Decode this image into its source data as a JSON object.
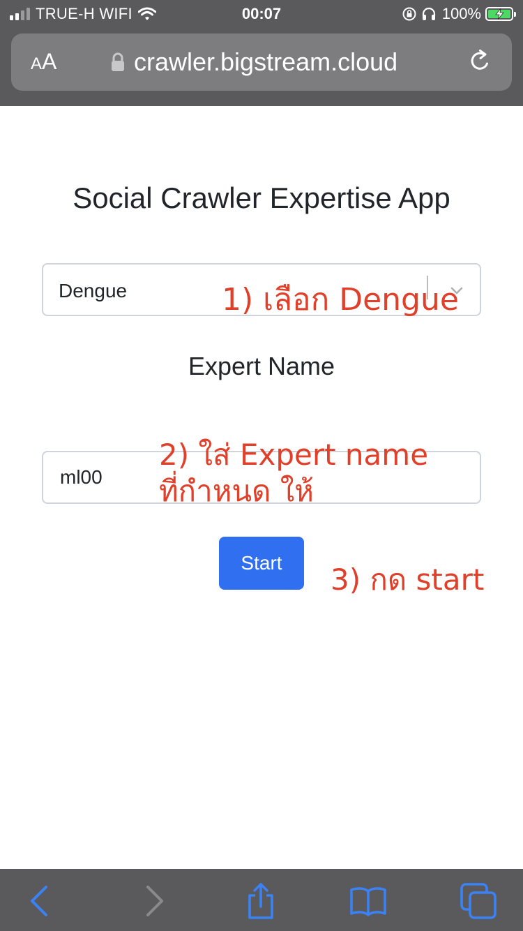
{
  "status_bar": {
    "carrier": "TRUE-H WIFI",
    "time": "00:07",
    "battery_percent": "100%",
    "signal_bars_active": 2,
    "signal_bars_total": 4,
    "battery_level": 1.0,
    "charging": true
  },
  "browser": {
    "text_size_label_small": "A",
    "text_size_label_large": "A",
    "url": "crawler.bigstream.cloud",
    "icons": {
      "lock": "lock-icon",
      "reload": "reload-icon",
      "back": "back-icon",
      "forward": "forward-icon",
      "share": "share-icon",
      "bookmarks": "bookmarks-icon",
      "tabs": "tabs-icon"
    }
  },
  "app": {
    "title": "Social Crawler Expertise App",
    "topic_select": {
      "selected": "Dengue",
      "options": [
        "Dengue"
      ]
    },
    "expert_label": "Expert Name",
    "expert_input": {
      "value": "ml00",
      "placeholder": ""
    },
    "start_label": "Start"
  },
  "annotations": {
    "step1": "1) เลือก Dengue",
    "step2_line1": "2) ใส่ Expert name",
    "step2_line2": "ที่กำหนด ให้",
    "step3": "3) กด start"
  },
  "colors": {
    "chrome_bg": "#5a5a5c",
    "address_bar_bg": "#7d7d80",
    "primary_button": "#2f6ff0",
    "annotation": "#e0402a",
    "toolbar_icon_active": "#3b82f6",
    "toolbar_icon_disabled": "#8a8a8c",
    "battery_fill": "#4cd964"
  }
}
